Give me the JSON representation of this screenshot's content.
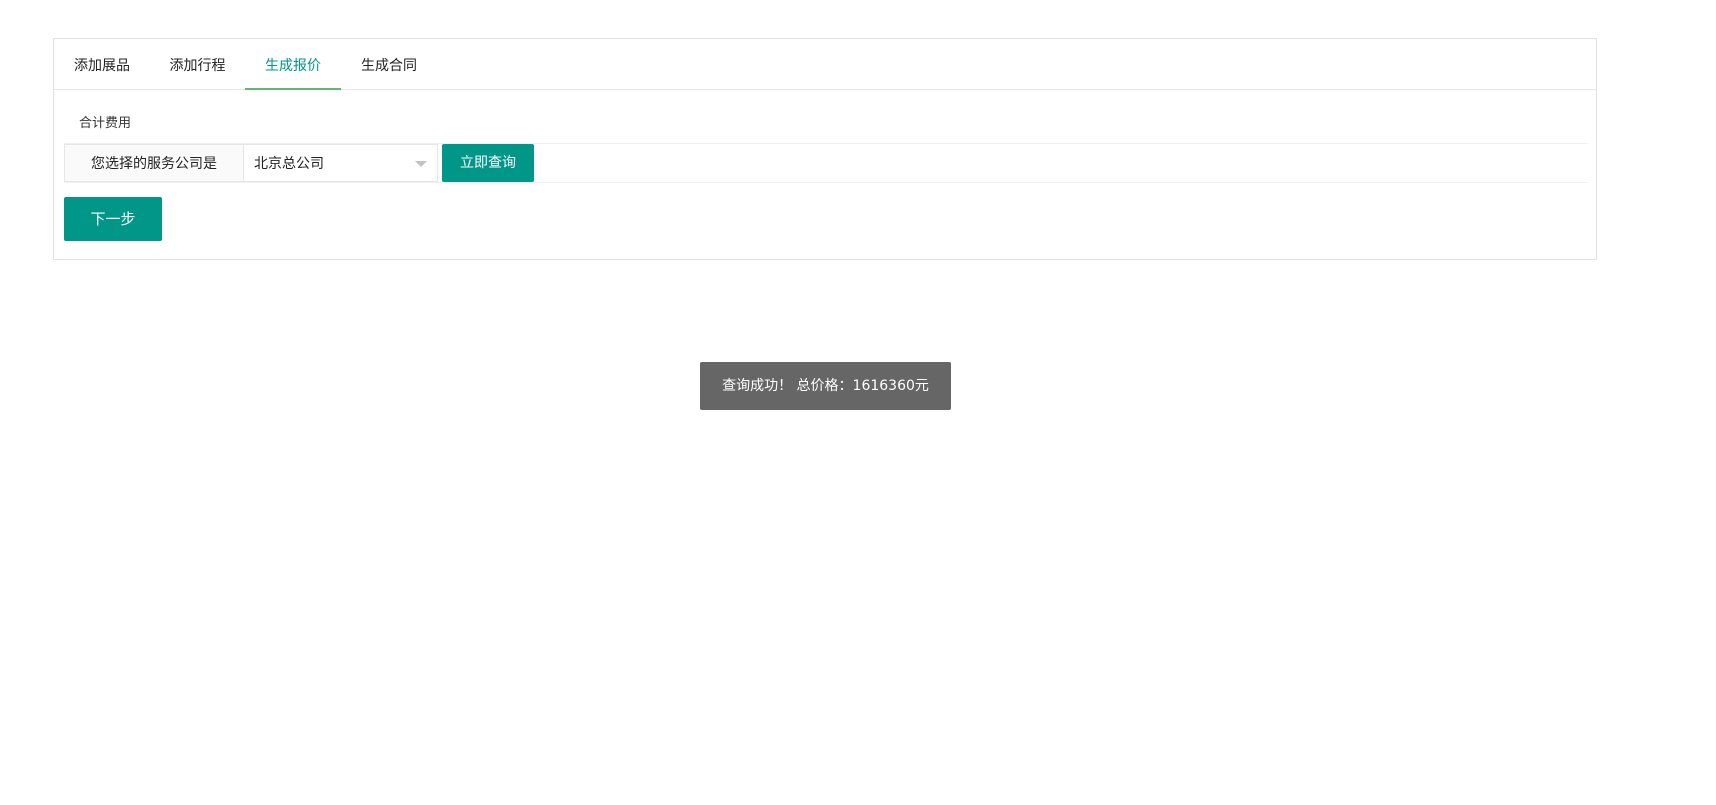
{
  "tabs": [
    {
      "label": "添加展品"
    },
    {
      "label": "添加行程"
    },
    {
      "label": "生成报价",
      "active": true
    },
    {
      "label": "生成合同"
    }
  ],
  "section_title": "合计费用",
  "query": {
    "label": "您选择的服务公司是",
    "select_value": "北京总公司",
    "button": "立即查询"
  },
  "next_button": "下一步",
  "toast": {
    "message": "查询成功！ 总价格：1616360元"
  },
  "colors": {
    "accent": "#009688",
    "tab_underline": "#5FB878",
    "toast_bg": "#666666"
  }
}
